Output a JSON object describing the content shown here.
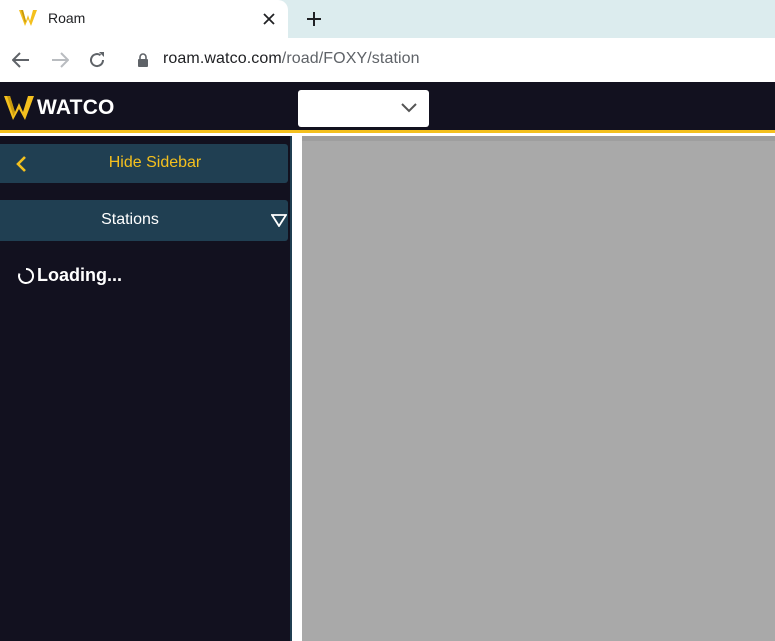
{
  "browser": {
    "tab": {
      "title": "Roam"
    },
    "address_bar": {
      "host": "roam.watco.com",
      "path": "/road/FOXY/station"
    }
  },
  "header": {
    "logo_text": "WATCO",
    "brand_color": "#f4c01e",
    "background_color": "#12111f",
    "selector": {
      "value": ""
    }
  },
  "sidebar": {
    "hide_button_label": "Hide Sidebar",
    "stations_label": "Stations",
    "loading_text": "Loading...",
    "panel_color": "#203f52"
  },
  "map": {
    "background_color": "#a9a9a9"
  }
}
